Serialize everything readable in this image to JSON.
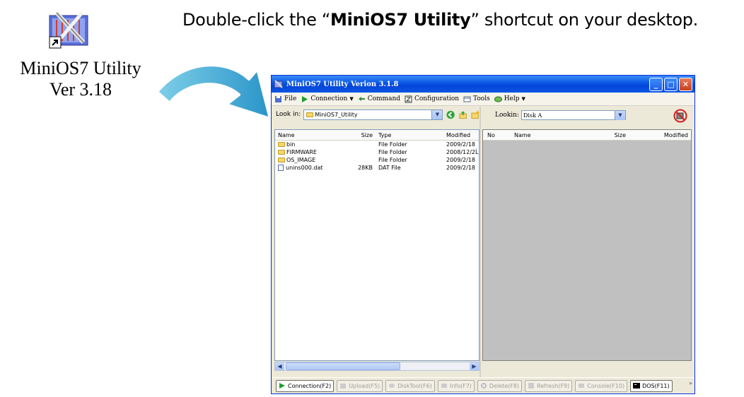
{
  "desktop": {
    "label_line1": "MiniOS7 Utility",
    "label_line2": "Ver 3.18"
  },
  "instruction": {
    "prefix": "Double-click the “",
    "bold": "MiniOS7 Utility",
    "suffix": "” shortcut on your desktop."
  },
  "window": {
    "title": "MiniOS7 Utility Verion 3.1.8",
    "menu": [
      {
        "label": "File",
        "icon": "floppy-icon",
        "dropdown": false
      },
      {
        "label": "Connection",
        "icon": "play-icon",
        "dropdown": true
      },
      {
        "label": "Command",
        "icon": "arrows-icon",
        "dropdown": false
      },
      {
        "label": "Configuration",
        "icon": "config-icon",
        "dropdown": false
      },
      {
        "label": "Tools",
        "icon": "tools-icon",
        "dropdown": false
      },
      {
        "label": "Help",
        "icon": "help-icon",
        "dropdown": true
      }
    ],
    "local": {
      "lookin_label": "Look in:",
      "lookin_value": "MiniOS7_Utility",
      "columns": {
        "name": "Name",
        "size": "Size",
        "type": "Type",
        "modified": "Modified"
      },
      "rows": [
        {
          "name": "bin",
          "size": "",
          "type": "File Folder",
          "modified": "2009/2/18",
          "kind": "folder"
        },
        {
          "name": "FIRMWARE",
          "size": "",
          "type": "File Folder",
          "modified": "2008/12/2Ĺ",
          "kind": "folder"
        },
        {
          "name": "OS_IMAGE",
          "size": "",
          "type": "File Folder",
          "modified": "2009/2/18",
          "kind": "folder"
        },
        {
          "name": "unins000.dat",
          "size": "28KB",
          "type": "DAT File",
          "modified": "2009/2/18",
          "kind": "file"
        }
      ]
    },
    "remote": {
      "lookin_label": "Lookin:",
      "lookin_value": "Disk A",
      "columns": {
        "no": "No",
        "name": "Name",
        "size": "Size",
        "modified": "Modified"
      }
    },
    "toolbar": [
      {
        "label": "Connection(F2)",
        "enabled": true
      },
      {
        "label": "Upload(F5)",
        "enabled": false
      },
      {
        "label": "DiskTool(F6)",
        "enabled": false
      },
      {
        "label": "Info(F7)",
        "enabled": false
      },
      {
        "label": "Delete(F8)",
        "enabled": false
      },
      {
        "label": "Refresh(F9)",
        "enabled": false
      },
      {
        "label": "Console(F10)",
        "enabled": false
      },
      {
        "label": "DOS(F11)",
        "enabled": true
      }
    ],
    "toolbar_more": "»"
  },
  "colors": {
    "titlebar": "#0a55e4",
    "remote_bg": "#c0c0c0",
    "window_bg": "#ece9d8"
  }
}
